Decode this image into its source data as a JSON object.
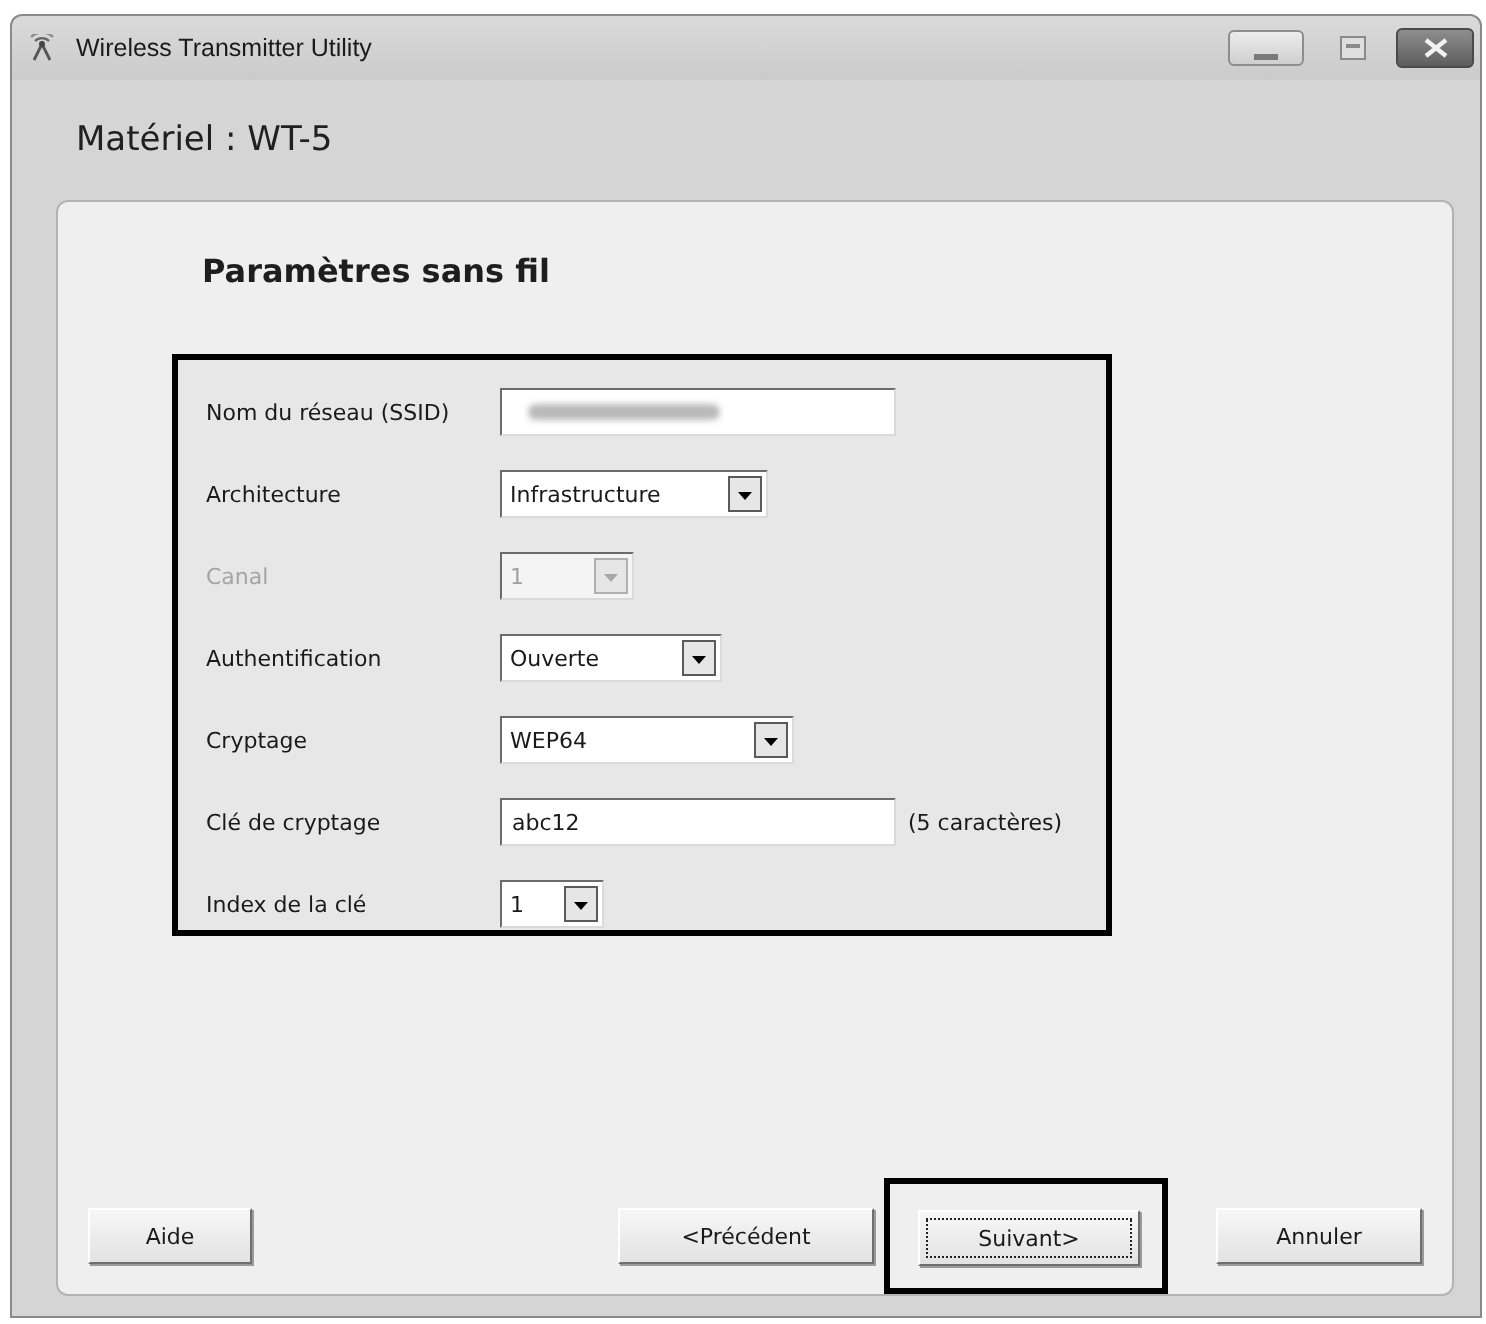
{
  "window": {
    "title": "Wireless Transmitter Utility"
  },
  "device": {
    "label": "Matériel : WT-5"
  },
  "section": {
    "title": "Paramètres sans fil"
  },
  "form": {
    "highlighted": true,
    "fields": [
      {
        "kind": "text",
        "label": "Nom du réseau (SSID)",
        "obscured": true,
        "disabled": false
      },
      {
        "kind": "select",
        "label": "Architecture",
        "value": "Infrastructure",
        "disabled": false
      },
      {
        "kind": "select",
        "label": "Canal",
        "value": "1",
        "disabled": true
      },
      {
        "kind": "select",
        "label": "Authentification",
        "value": "Ouverte",
        "disabled": false
      },
      {
        "kind": "select",
        "label": "Cryptage",
        "value": "WEP64",
        "disabled": false
      },
      {
        "kind": "text",
        "label": "Clé de cryptage",
        "value": "abc12",
        "note": "(5 caractères)",
        "disabled": false
      },
      {
        "kind": "select",
        "label": "Index de la clé",
        "value": "1",
        "disabled": false
      }
    ]
  },
  "buttons": [
    {
      "label": "Aide",
      "focused": false,
      "highlighted": false
    },
    {
      "label": "<Précédent",
      "focused": false,
      "highlighted": false
    },
    {
      "label": "Suivant>",
      "focused": true,
      "highlighted": true
    },
    {
      "label": "Annuler",
      "focused": false,
      "highlighted": false
    }
  ]
}
